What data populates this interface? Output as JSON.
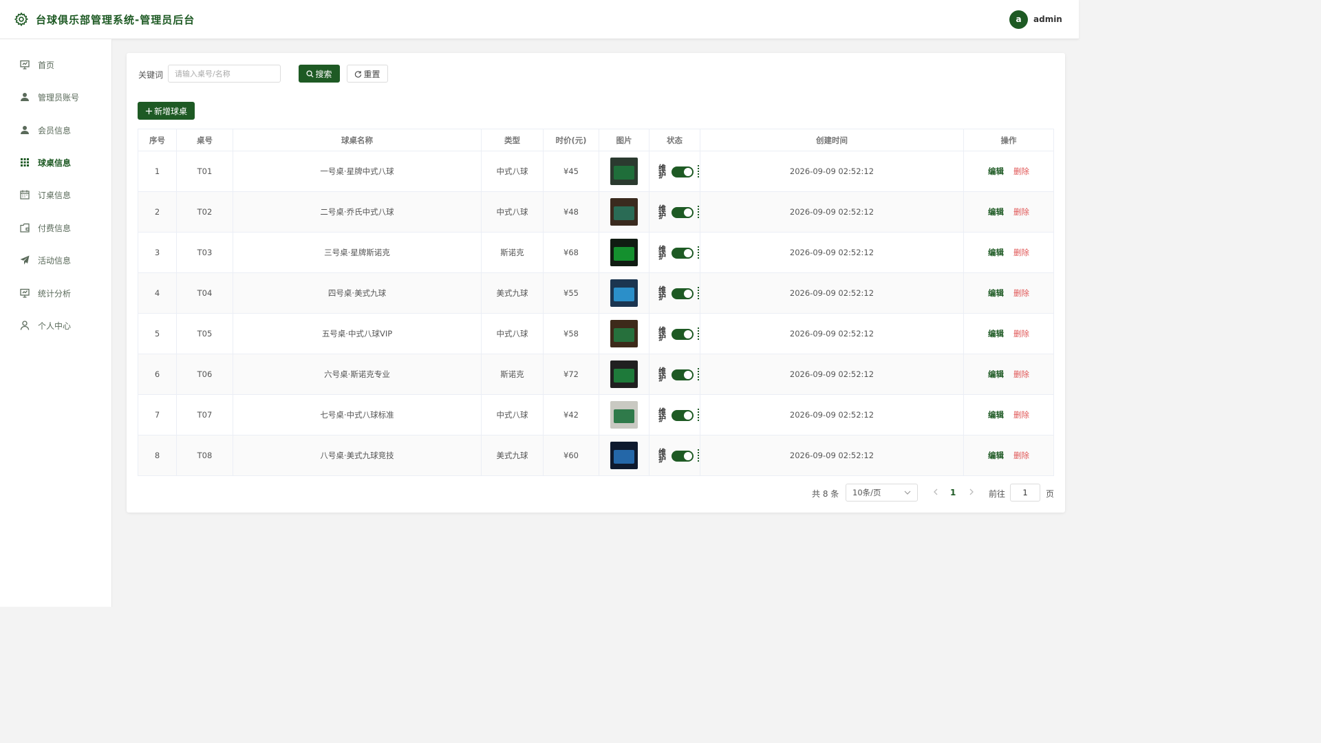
{
  "header": {
    "title": "台球俱乐部管理系统-管理员后台",
    "avatar_letter": "a",
    "username": "admin"
  },
  "sidebar": {
    "items": [
      {
        "label": "首页",
        "icon": "presentation-icon"
      },
      {
        "label": "管理员账号",
        "icon": "user-icon"
      },
      {
        "label": "会员信息",
        "icon": "user-icon"
      },
      {
        "label": "球桌信息",
        "icon": "grid-icon",
        "active": true
      },
      {
        "label": "订桌信息",
        "icon": "calendar-icon"
      },
      {
        "label": "付费信息",
        "icon": "wallet-icon"
      },
      {
        "label": "活动信息",
        "icon": "send-icon"
      },
      {
        "label": "统计分析",
        "icon": "chart-icon"
      },
      {
        "label": "个人中心",
        "icon": "person-outline-icon"
      }
    ]
  },
  "search": {
    "label": "关键词",
    "placeholder": "请输入桌号/名称",
    "value": "",
    "search_button": "搜索",
    "reset_button": "重置"
  },
  "add_button": "新增球桌",
  "table": {
    "columns": [
      "序号",
      "桌号",
      "球桌名称",
      "类型",
      "时价(元)",
      "图片",
      "状态",
      "创建时间",
      "操作"
    ],
    "status_label": "维护",
    "edit_label": "编辑",
    "delete_label": "删除",
    "rows": [
      {
        "index": "1",
        "code": "T01",
        "name": "一号桌·星牌中式八球",
        "type": "中式八球",
        "price": "¥45",
        "created": "2026-09-09 02:52:12"
      },
      {
        "index": "2",
        "code": "T02",
        "name": "二号桌·乔氏中式八球",
        "type": "中式八球",
        "price": "¥48",
        "created": "2026-09-09 02:52:12"
      },
      {
        "index": "3",
        "code": "T03",
        "name": "三号桌·星牌斯诺克",
        "type": "斯诺克",
        "price": "¥68",
        "created": "2026-09-09 02:52:12"
      },
      {
        "index": "4",
        "code": "T04",
        "name": "四号桌·美式九球",
        "type": "美式九球",
        "price": "¥55",
        "created": "2026-09-09 02:52:12"
      },
      {
        "index": "5",
        "code": "T05",
        "name": "五号桌·中式八球VIP",
        "type": "中式八球",
        "price": "¥58",
        "created": "2026-09-09 02:52:12"
      },
      {
        "index": "6",
        "code": "T06",
        "name": "六号桌·斯诺克专业",
        "type": "斯诺克",
        "price": "¥72",
        "created": "2026-09-09 02:52:12"
      },
      {
        "index": "7",
        "code": "T07",
        "name": "七号桌·中式八球标准",
        "type": "中式八球",
        "price": "¥42",
        "created": "2026-09-09 02:52:12"
      },
      {
        "index": "8",
        "code": "T08",
        "name": "八号桌·美式九球竞技",
        "type": "美式九球",
        "price": "¥60",
        "created": "2026-09-09 02:52:12"
      }
    ]
  },
  "pagination": {
    "total": "共 8 条",
    "page_size": "10条/页",
    "current_page": "1",
    "goto_label": "前往",
    "goto_value": "1",
    "page_suffix": "页"
  },
  "colors": {
    "accent": "#1e5a24",
    "danger": "#e05555"
  }
}
